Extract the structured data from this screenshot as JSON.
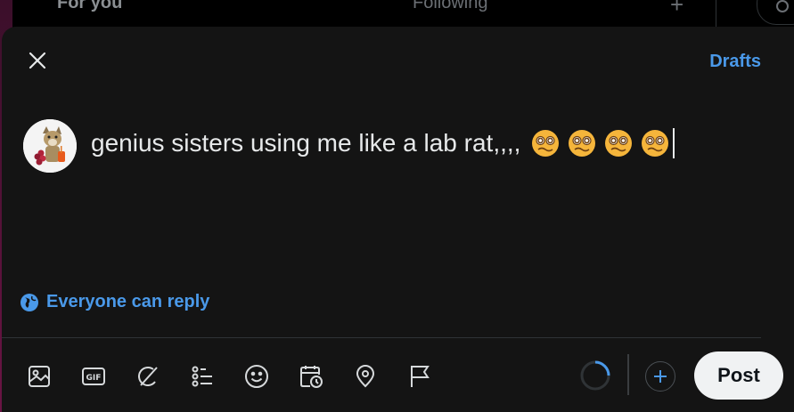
{
  "background": {
    "tabs": [
      "For you",
      "Following"
    ]
  },
  "composer": {
    "drafts_label": "Drafts",
    "text": "genius sisters using me like a lab rat,,,,",
    "emojis": [
      "woozy-face",
      "woozy-face",
      "woozy-face",
      "woozy-face"
    ],
    "reply_setting": "Everyone can reply",
    "post_label": "Post",
    "toolbar_icons": [
      "media-icon",
      "gif-icon",
      "grok-icon",
      "poll-icon",
      "emoji-icon",
      "schedule-icon",
      "location-icon",
      "flag-icon"
    ]
  },
  "colors": {
    "accent": "#4a99e9",
    "modal_bg": "#141414",
    "post_button_bg": "#f0f2f3"
  }
}
